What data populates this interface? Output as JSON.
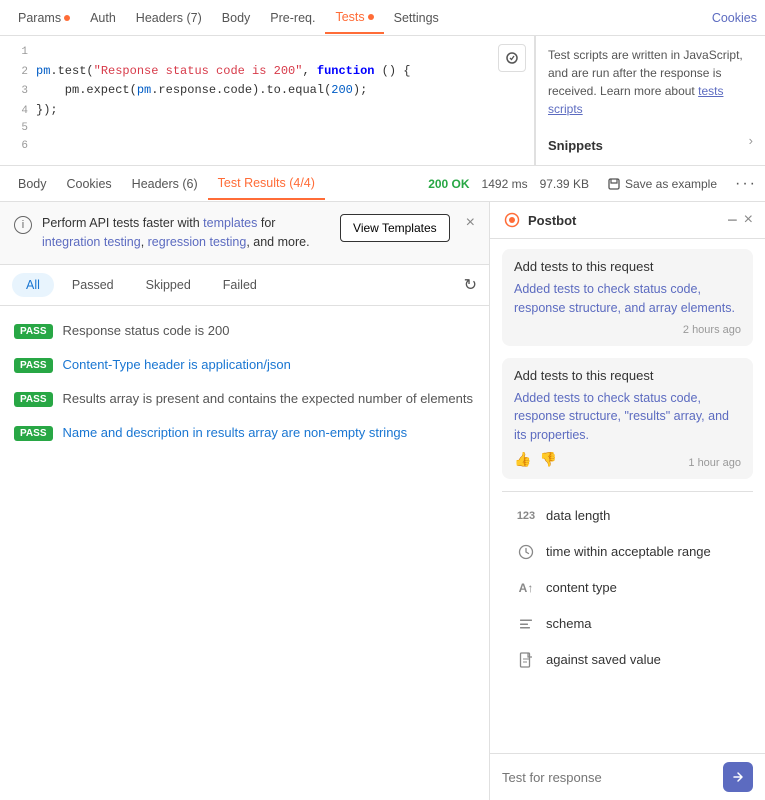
{
  "nav": {
    "tabs": [
      {
        "label": "Params",
        "dot": true,
        "active": false
      },
      {
        "label": "Auth",
        "dot": false,
        "active": false
      },
      {
        "label": "Headers (7)",
        "dot": false,
        "active": false
      },
      {
        "label": "Body",
        "dot": false,
        "active": false
      },
      {
        "label": "Pre-req.",
        "dot": false,
        "active": false
      },
      {
        "label": "Tests",
        "dot": true,
        "active": true
      },
      {
        "label": "Settings",
        "dot": false,
        "active": false
      }
    ],
    "cookies": "Cookies"
  },
  "code": {
    "lines": [
      {
        "num": "1",
        "content": ""
      },
      {
        "num": "2",
        "content": "pm.test(\"Response status code is 200\", function () {"
      },
      {
        "num": "3",
        "content": "    pm.expect(pm.response.code).to.equal(200);"
      },
      {
        "num": "4",
        "content": "});"
      },
      {
        "num": "5",
        "content": ""
      },
      {
        "num": "6",
        "content": ""
      }
    ]
  },
  "snippets": {
    "helpText": "Test scripts are written in JavaScript, and are run after the response is received. Learn more about",
    "link": "tests scripts",
    "title": "Snippets"
  },
  "responseTabs": {
    "tabs": [
      {
        "label": "Body",
        "active": false
      },
      {
        "label": "Cookies",
        "active": false
      },
      {
        "label": "Headers (6)",
        "active": false
      },
      {
        "label": "Test Results (4/4)",
        "active": true
      }
    ],
    "statusCode": "200 OK",
    "time": "1492 ms",
    "size": "97.39 KB",
    "saveLabel": "Save as example",
    "moreIcon": "···"
  },
  "banner": {
    "text": "Perform API tests faster with templates for integration testing, regression testing, and more.",
    "viewBtn": "View Templates"
  },
  "filterTabs": {
    "tabs": [
      {
        "label": "All",
        "active": true
      },
      {
        "label": "Passed",
        "active": false
      },
      {
        "label": "Skipped",
        "active": false
      },
      {
        "label": "Failed",
        "active": false
      }
    ]
  },
  "testResults": [
    {
      "badge": "PASS",
      "label": "Response status code is 200"
    },
    {
      "badge": "PASS",
      "label": "Content-Type header is application/json"
    },
    {
      "badge": "PASS",
      "label": "Results array is present and contains the expected number of elements"
    },
    {
      "badge": "PASS",
      "label": "Name and description in results array are non-empty strings"
    }
  ],
  "postbot": {
    "title": "Postbot",
    "messages": [
      {
        "prompt": "Add tests to this request",
        "response": "Added tests to check status code, response structure, and array elements.",
        "time": "2 hours ago",
        "hasFeedback": false
      },
      {
        "prompt": "Add tests to this request",
        "response": "Added tests to check status code, response structure, \"results\" array, and its properties.",
        "time": "1 hour ago",
        "hasFeedback": true
      }
    ],
    "quickActions": [
      {
        "icon": "123",
        "label": "data length",
        "iconType": "text"
      },
      {
        "icon": "clock",
        "label": "time within acceptable range",
        "iconType": "clock"
      },
      {
        "icon": "AT",
        "label": "content type",
        "iconType": "at"
      },
      {
        "icon": "lines",
        "label": "schema",
        "iconType": "schema"
      },
      {
        "icon": "file",
        "label": "against saved value",
        "iconType": "file"
      }
    ],
    "inputPlaceholder": "Test for response"
  }
}
